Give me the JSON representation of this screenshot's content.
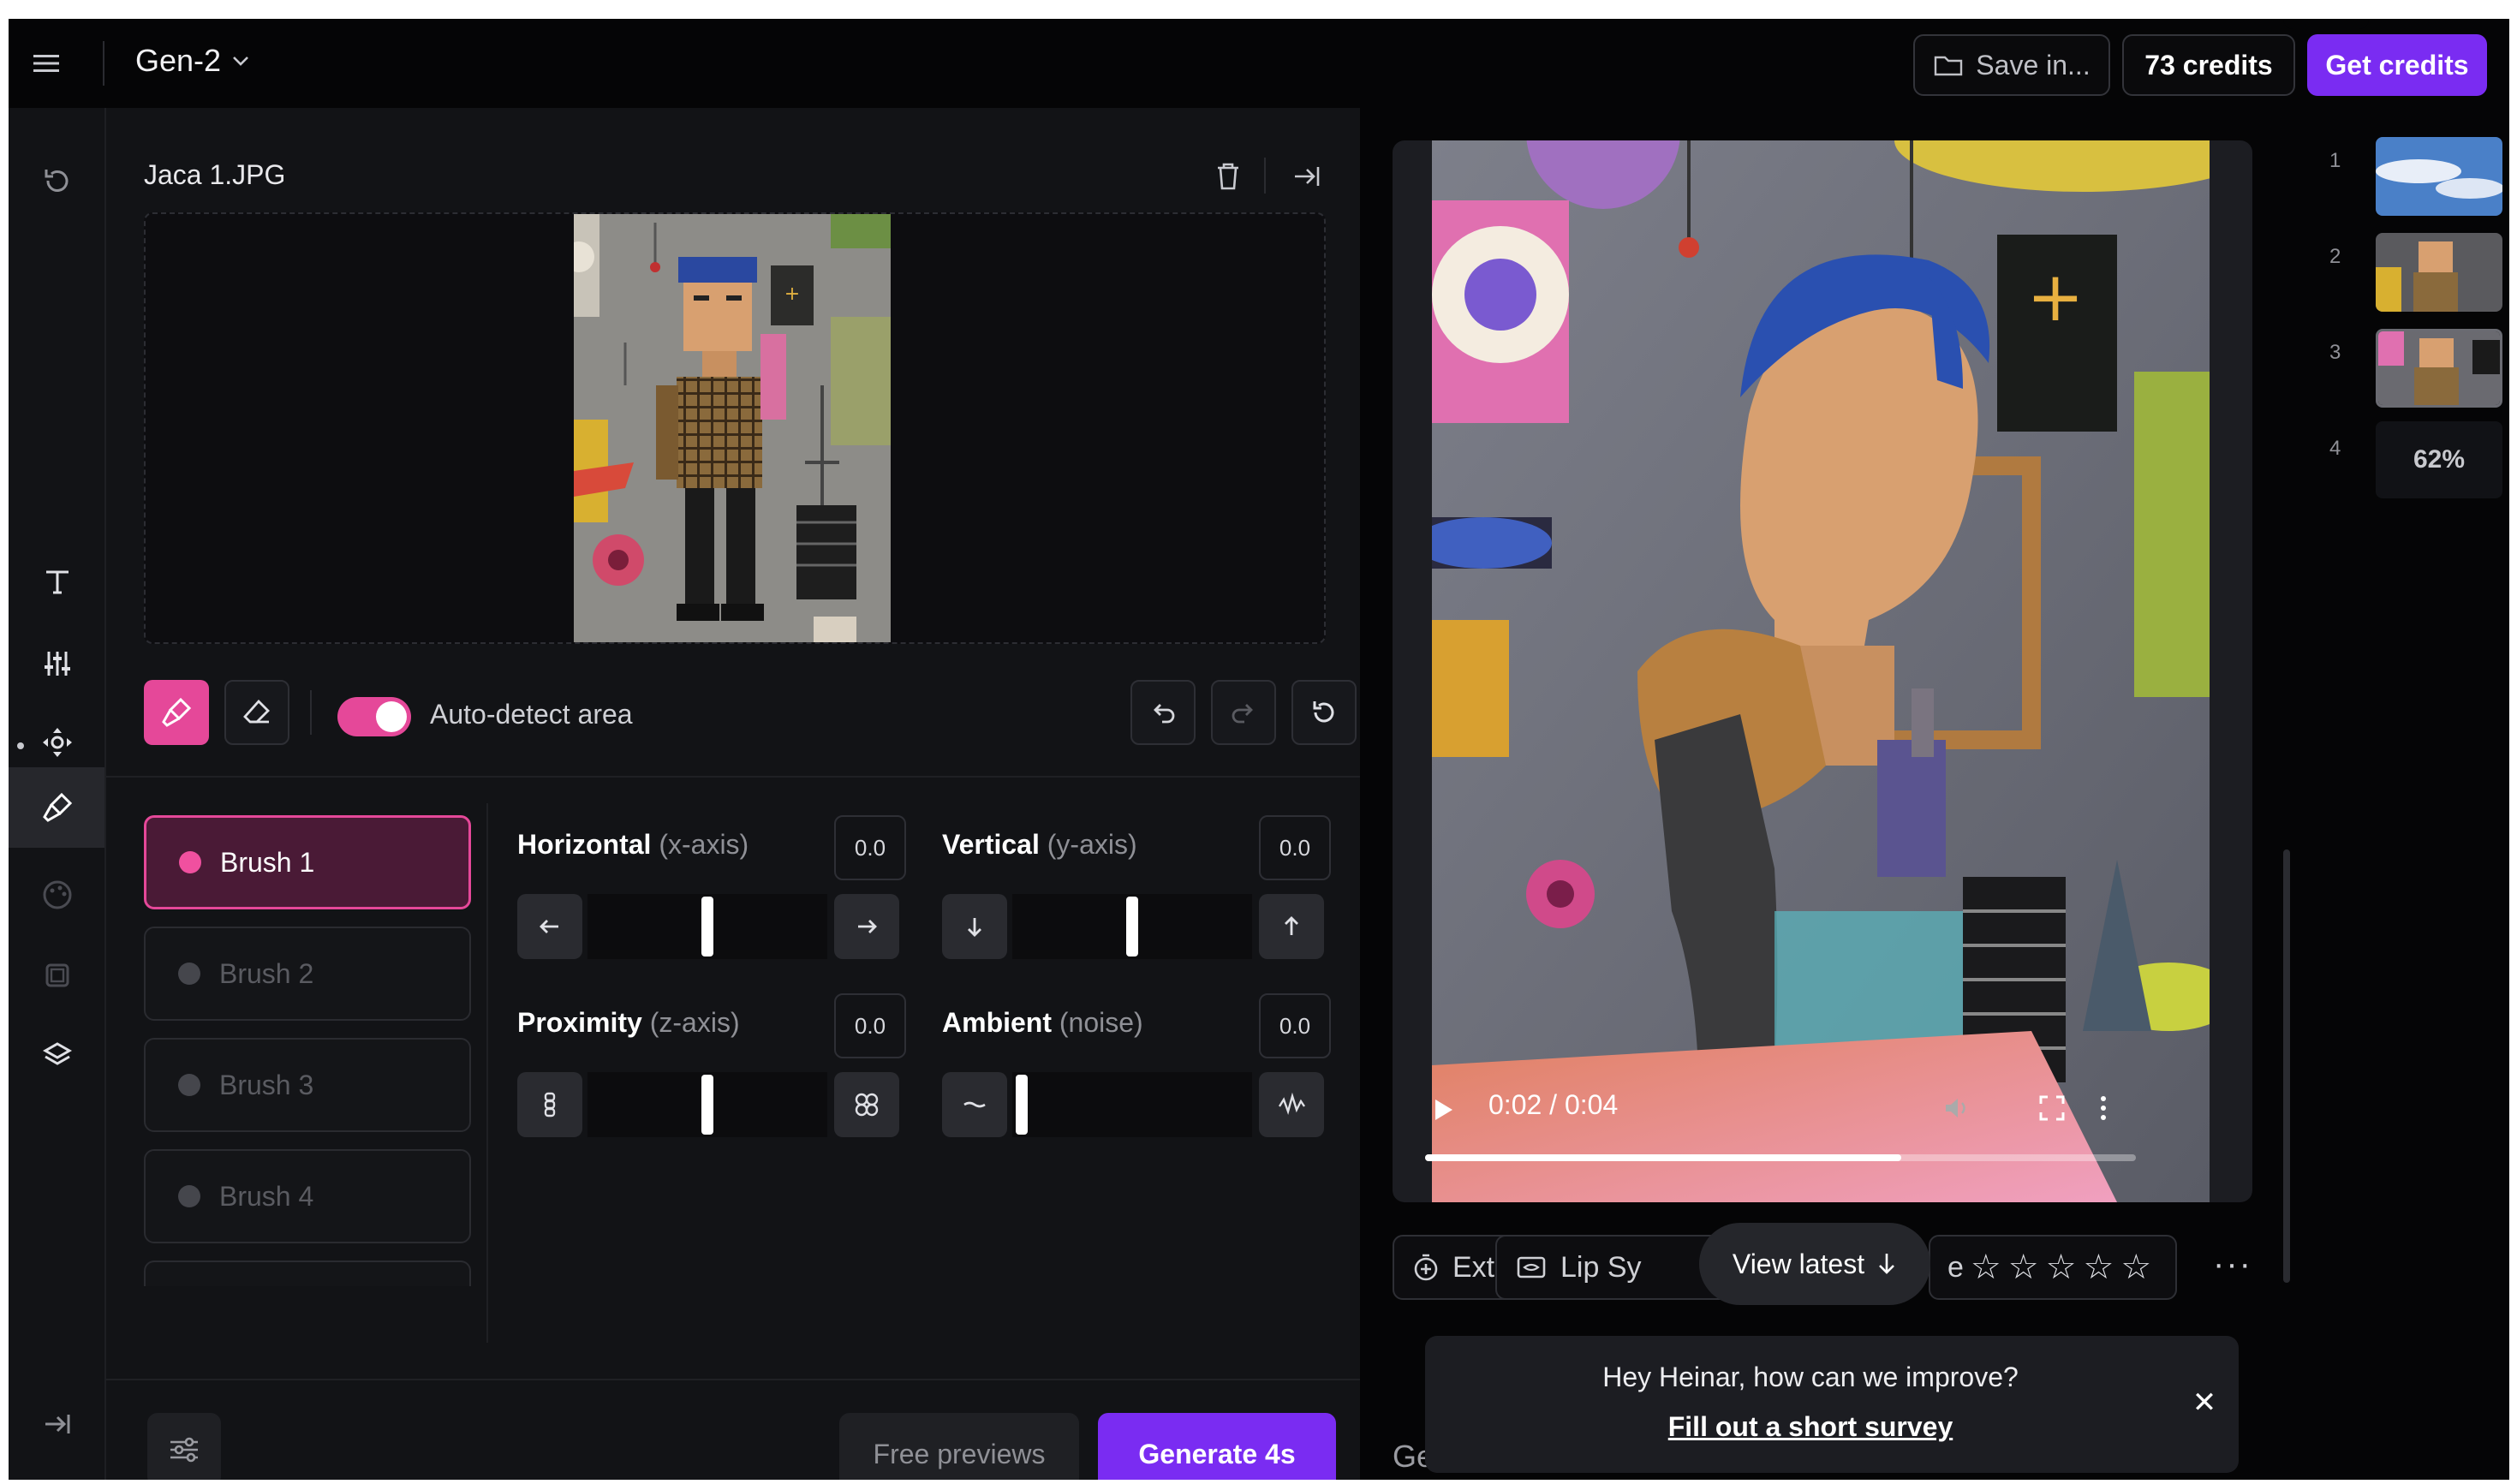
{
  "topbar": {
    "menu_icon": "hamburger-menu-icon",
    "model_title": "Gen-2",
    "save_label": "Save in...",
    "credits_label": "73 credits",
    "get_credits_label": "Get credits",
    "accent_color": "#7a2cf2"
  },
  "rail": {
    "items": [
      "history-icon",
      "text-icon",
      "sliders-icon",
      "camera-motion-icon",
      "motion-brush-icon",
      "palette-icon",
      "frames-icon",
      "layers-icon",
      "collapse-icon"
    ]
  },
  "editor": {
    "file_name": "Jaca 1.JPG",
    "auto_detect_label": "Auto-detect area",
    "auto_detect_on": true,
    "brush_color": "#e54899",
    "brushes": [
      {
        "label": "Brush 1",
        "active": true
      },
      {
        "label": "Brush 2",
        "active": false
      },
      {
        "label": "Brush 3",
        "active": false
      },
      {
        "label": "Brush 4",
        "active": false
      }
    ],
    "controls": {
      "horizontal": {
        "label": "Horizontal",
        "sub": "(x-axis)",
        "value": "0.0",
        "level": 0.5
      },
      "vertical": {
        "label": "Vertical",
        "sub": "(y-axis)",
        "value": "0.0",
        "level": 0.5
      },
      "proximity": {
        "label": "Proximity",
        "sub": "(z-axis)",
        "value": "0.0",
        "level": 0.5
      },
      "ambient": {
        "label": "Ambient",
        "sub": "(noise)",
        "value": "0.0",
        "level": 0.0
      }
    },
    "free_previews_label": "Free previews",
    "generate_label": "Generate 4s"
  },
  "player": {
    "time": "0:02 / 0:04",
    "progress": 0.67,
    "extend_label": "Extend",
    "lipsync_label": "Lip Sy",
    "stars_prefix": "e",
    "view_latest_label": "View latest",
    "ge_text": "Ge"
  },
  "history": {
    "items": [
      {
        "num": "1"
      },
      {
        "num": "2"
      },
      {
        "num": "3"
      },
      {
        "num": "4",
        "progress_label": "62%"
      }
    ]
  },
  "survey": {
    "question": "Hey Heinar, how can we improve?",
    "link": "Fill out a short survey"
  }
}
